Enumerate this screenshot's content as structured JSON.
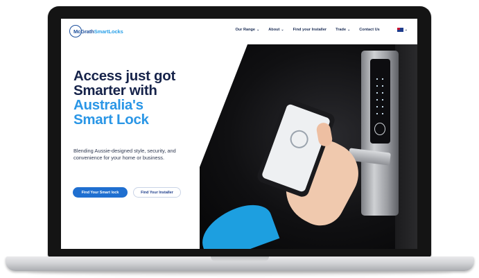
{
  "logo": {
    "part1": "McGrath",
    "part2": "SmartLocks"
  },
  "nav": {
    "items": [
      {
        "label": "Our Range",
        "chevron": true
      },
      {
        "label": "About",
        "chevron": true
      },
      {
        "label": "Find your Installer",
        "chevron": false
      },
      {
        "label": "Trade",
        "chevron": true
      },
      {
        "label": "Contact Us",
        "chevron": false
      }
    ],
    "flag": "australia-flag-icon"
  },
  "hero": {
    "title_line1": "Access just got",
    "title_line2": "Smarter with",
    "title_line3": "Australia's",
    "title_line4": "Smart Lock",
    "subtitle": "Blending Aussie-designed style, security, and convenience for your home or business.",
    "primary_button": "Find Your Smart lock",
    "secondary_button": "Find Your Installer"
  },
  "colors": {
    "navy": "#16234a",
    "accent_blue": "#2a96e6",
    "button_blue": "#1f6fd0"
  }
}
